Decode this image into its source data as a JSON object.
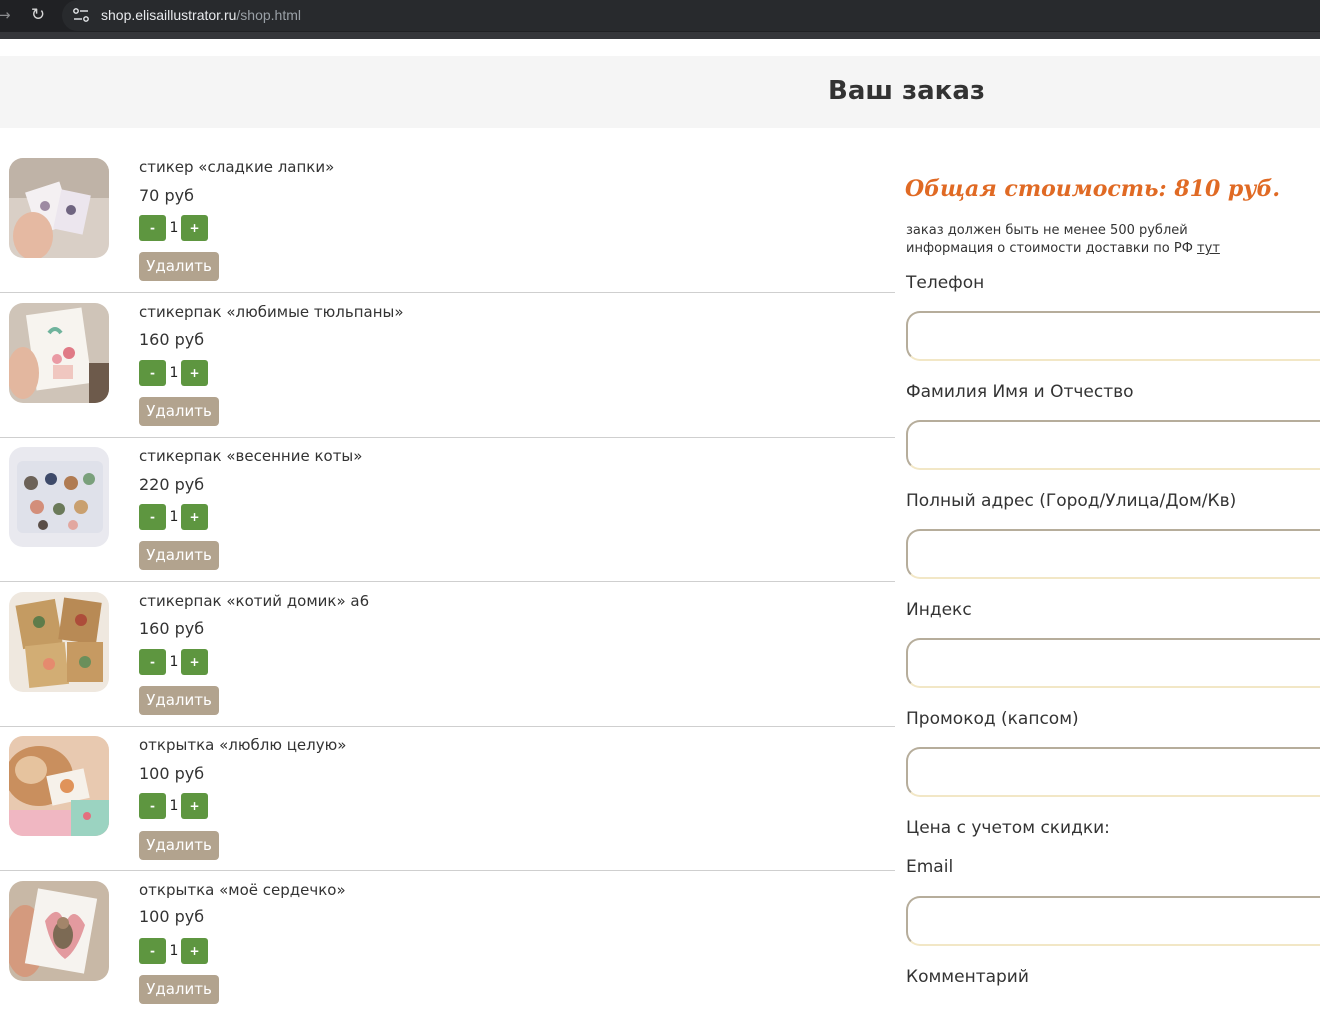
{
  "browser": {
    "url_host": "shop.elisaillustrator.ru",
    "url_path": "/shop.html"
  },
  "page": {
    "title": "Ваш заказ"
  },
  "cart": {
    "items": [
      {
        "name": "стикер «сладкие лапки»",
        "price": "70 руб",
        "qty": "1",
        "minus": "-",
        "plus": "+",
        "delete": "Удалить"
      },
      {
        "name": "стикерпак «любимые тюльпаны»",
        "price": "160 руб",
        "qty": "1",
        "minus": "-",
        "plus": "+",
        "delete": "Удалить"
      },
      {
        "name": "стикерпак «весенние коты»",
        "price": "220 руб",
        "qty": "1",
        "minus": "-",
        "plus": "+",
        "delete": "Удалить"
      },
      {
        "name": "стикерпак «котий домик» а6",
        "price": "160 руб",
        "qty": "1",
        "minus": "-",
        "plus": "+",
        "delete": "Удалить"
      },
      {
        "name": "открытка «люблю целую»",
        "price": "100 руб",
        "qty": "1",
        "minus": "-",
        "plus": "+",
        "delete": "Удалить"
      },
      {
        "name": "открытка «моё сердечко»",
        "price": "100 руб",
        "qty": "1",
        "minus": "-",
        "plus": "+",
        "delete": "Удалить"
      }
    ]
  },
  "order_form": {
    "total": "Общая стоимость: 810 руб.",
    "min_order_note": "заказ должен быть не менее 500 рублей",
    "delivery_note": "информация о стоимости доставки по РФ",
    "delivery_link": "тут",
    "phone_label": "Телефон",
    "name_label": "Фамилия Имя и Отчество",
    "address_label": "Полный адрес (Город/Улица/Дом/Кв)",
    "index_label": "Индекс",
    "promo_label": "Промокод (капсом)",
    "discount_price_label": "Цена с учетом скидки:",
    "email_label": "Email",
    "comment_label": "Комментарий"
  },
  "colors": {
    "accent_green": "#5e9640",
    "delete_beige": "#b2a38e",
    "total_orange": "#e06a24"
  }
}
